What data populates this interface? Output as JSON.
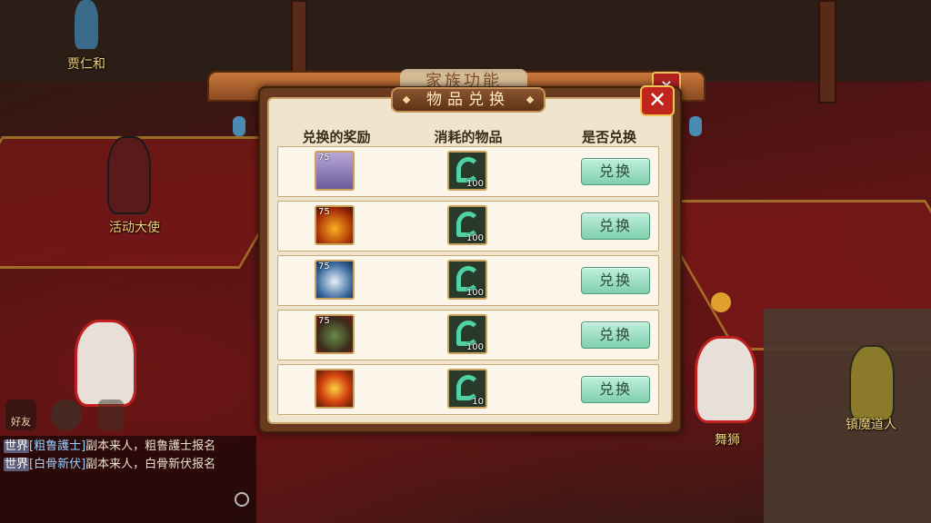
{
  "scene": {
    "npc_labels": [
      "贾仁和",
      "活动大使",
      "舞狮",
      "镇魔道人"
    ]
  },
  "hud": {
    "friends_label": "好友"
  },
  "chat": {
    "lines": [
      {
        "tag": "世界",
        "name": "[粗鲁護士]",
        "text": "副本来人，粗鲁護士报名"
      },
      {
        "tag": "世界",
        "name": "[白骨新伏]",
        "text": "副本来人，白骨新伏报名"
      }
    ]
  },
  "back_panel": {
    "title": "家族功能",
    "close": "×"
  },
  "dialog": {
    "title": "物品兑换",
    "close": "✕",
    "columns": [
      "兑换的奖励",
      "消耗的物品",
      "是否兑换"
    ],
    "rows": [
      {
        "reward_level": "75",
        "reward_icon": "bone-spirit-portrait-icon",
        "cost_icon": "jade-dragon-icon",
        "cost_qty": "100",
        "button": "兑换"
      },
      {
        "reward_level": "75",
        "reward_icon": "flame-demon-portrait-icon",
        "cost_icon": "jade-dragon-icon",
        "cost_qty": "100",
        "button": "兑换"
      },
      {
        "reward_level": "75",
        "reward_icon": "blue-beast-portrait-icon",
        "cost_icon": "jade-dragon-icon",
        "cost_qty": "100",
        "button": "兑换"
      },
      {
        "reward_level": "75",
        "reward_icon": "green-demon-portrait-icon",
        "cost_icon": "jade-dragon-icon",
        "cost_qty": "100",
        "button": "兑换"
      },
      {
        "reward_level": "",
        "reward_icon": "golden-monkey-portrait-icon",
        "cost_icon": "jade-dragon-icon",
        "cost_qty": "10",
        "button": "兑换"
      }
    ]
  },
  "colors": {
    "dialog_bg": "#efe4cc",
    "frame": "#6a3a1e",
    "button": "#7fcfae",
    "close_red": "#c0261e"
  }
}
